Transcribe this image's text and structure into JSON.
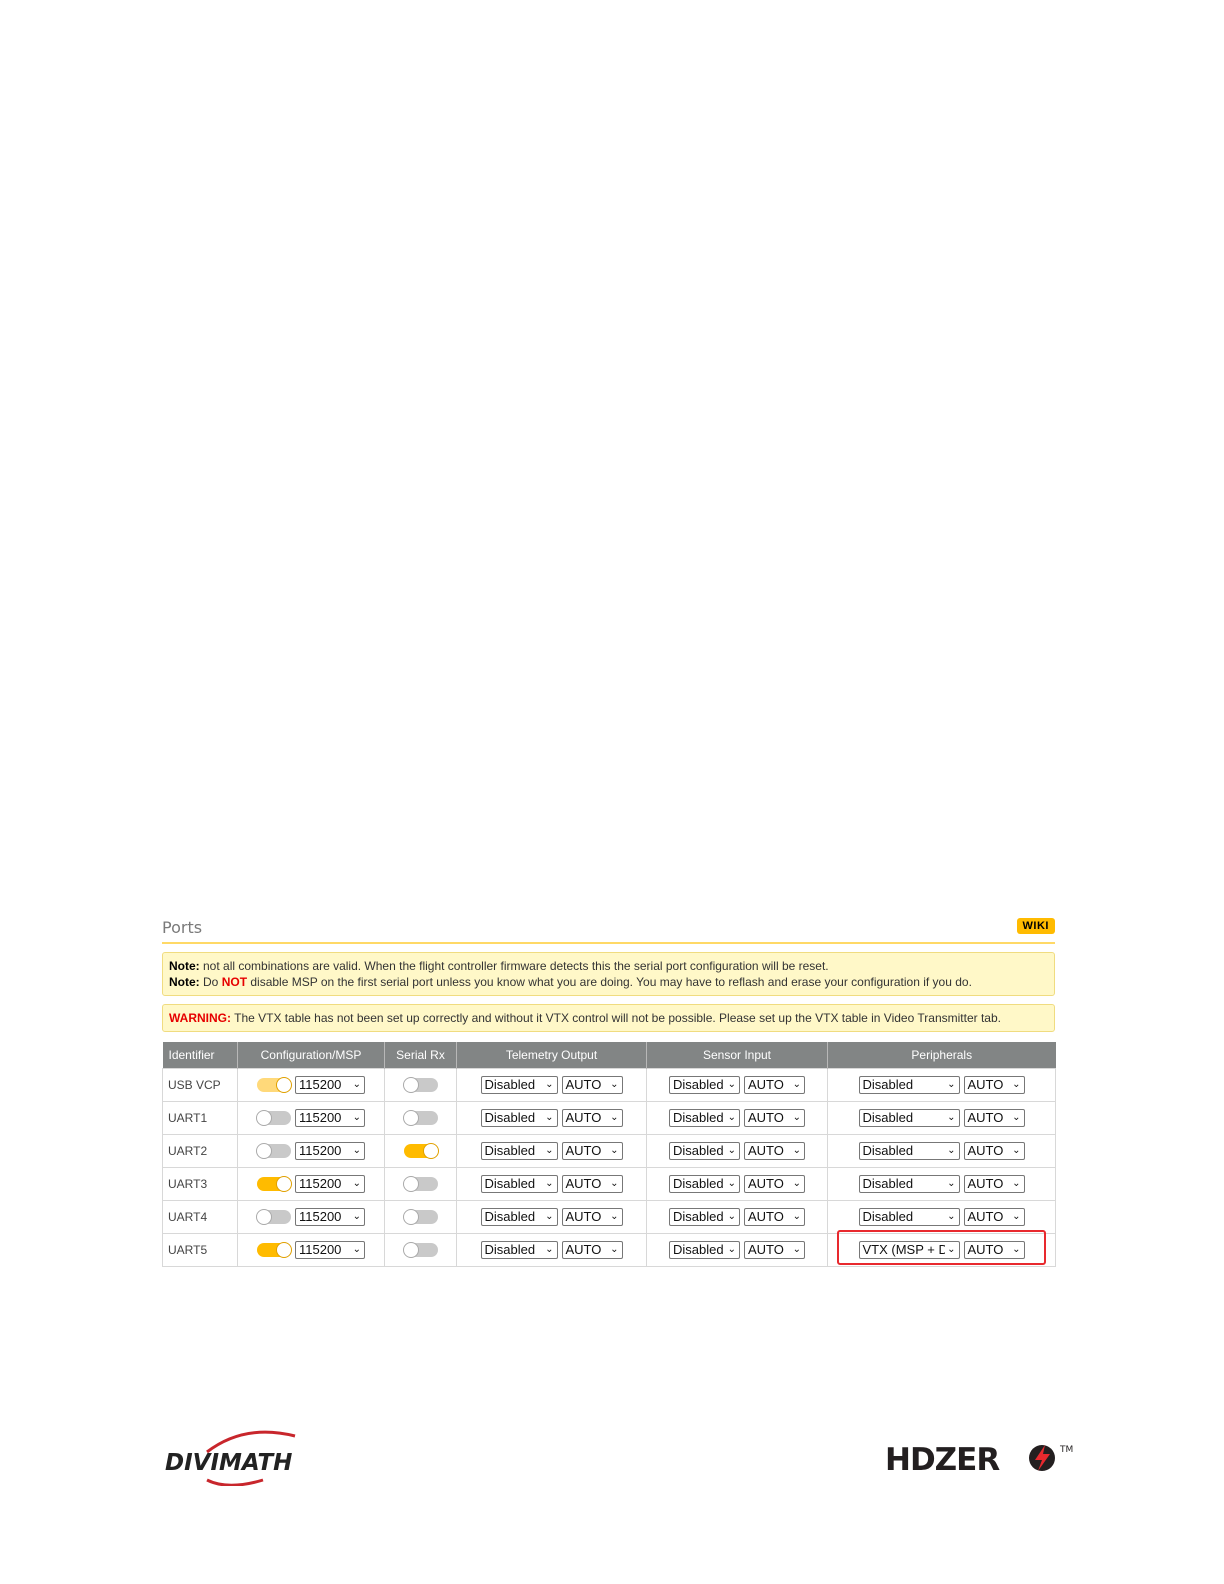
{
  "panel": {
    "title": "Ports",
    "wiki_label": "WIKI"
  },
  "notes": {
    "note1_label": "Note:",
    "note1_text": " not all combinations are valid. When the flight controller firmware detects this the serial port configuration will be reset.",
    "note2_label": "Note:",
    "note2_pre": " Do ",
    "note2_not": "NOT",
    "note2_post": " disable MSP on the first serial port unless you know what you are doing. You may have to reflash and erase your configuration if you do."
  },
  "warning": {
    "label": "WARNING:",
    "text": " The VTX table has not been set up correctly and without it VTX control will not be possible. Please set up the VTX table in Video Transmitter tab."
  },
  "table": {
    "headers": [
      "Identifier",
      "Configuration/MSP",
      "Serial Rx",
      "Telemetry Output",
      "Sensor Input",
      "Peripherals"
    ],
    "rows": [
      {
        "id": "USB VCP",
        "msp_on": true,
        "msp_dim": true,
        "baud": "115200",
        "serial_rx": false,
        "telemetry": "Disabled",
        "telemetry_baud": "AUTO",
        "sensor": "Disabled",
        "sensor_baud": "AUTO",
        "peripherals": "Disabled",
        "peripherals_baud": "AUTO"
      },
      {
        "id": "UART1",
        "msp_on": false,
        "msp_dim": false,
        "baud": "115200",
        "serial_rx": false,
        "telemetry": "Disabled",
        "telemetry_baud": "AUTO",
        "sensor": "Disabled",
        "sensor_baud": "AUTO",
        "peripherals": "Disabled",
        "peripherals_baud": "AUTO"
      },
      {
        "id": "UART2",
        "msp_on": false,
        "msp_dim": false,
        "baud": "115200",
        "serial_rx": true,
        "telemetry": "Disabled",
        "telemetry_baud": "AUTO",
        "sensor": "Disabled",
        "sensor_baud": "AUTO",
        "peripherals": "Disabled",
        "peripherals_baud": "AUTO"
      },
      {
        "id": "UART3",
        "msp_on": true,
        "msp_dim": false,
        "baud": "115200",
        "serial_rx": false,
        "telemetry": "Disabled",
        "telemetry_baud": "AUTO",
        "sensor": "Disabled",
        "sensor_baud": "AUTO",
        "peripherals": "Disabled",
        "peripherals_baud": "AUTO"
      },
      {
        "id": "UART4",
        "msp_on": false,
        "msp_dim": false,
        "baud": "115200",
        "serial_rx": false,
        "telemetry": "Disabled",
        "telemetry_baud": "AUTO",
        "sensor": "Disabled",
        "sensor_baud": "AUTO",
        "peripherals": "Disabled",
        "peripherals_baud": "AUTO"
      },
      {
        "id": "UART5",
        "msp_on": true,
        "msp_dim": false,
        "baud": "115200",
        "serial_rx": false,
        "telemetry": "Disabled",
        "telemetry_baud": "AUTO",
        "sensor": "Disabled",
        "sensor_baud": "AUTO",
        "peripherals": "VTX (MSP + D",
        "peripherals_baud": "AUTO"
      }
    ]
  },
  "colors": {
    "accent": "#ffbb00",
    "header_bg": "#828585",
    "note_bg": "#fff8c8",
    "highlight": "#e8292e"
  },
  "logos": {
    "left": "DIVIMATH",
    "right": "HDZERO",
    "right_tm": "TM"
  }
}
